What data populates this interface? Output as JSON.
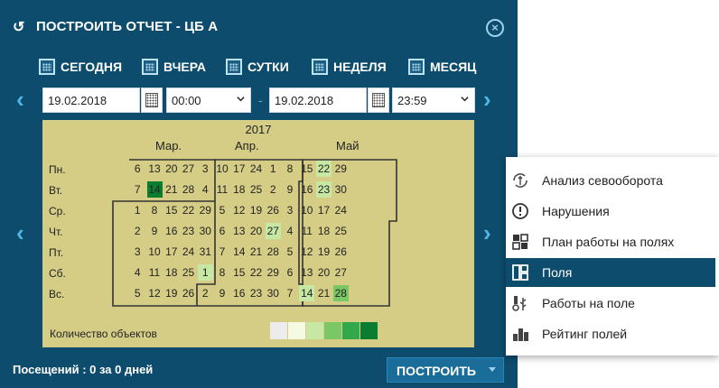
{
  "dialog": {
    "title": "ПОСТРОИТЬ ОТЧЕТ - ЦБ А",
    "quick_ranges": [
      "СЕГОДНЯ",
      "ВЧЕРА",
      "СУТКИ",
      "НЕДЕЛЯ",
      "МЕСЯЦ"
    ],
    "from_date": "19.02.2018",
    "from_time": "00:00",
    "separator": "-",
    "to_date": "19.02.2018",
    "to_time": "23:59"
  },
  "calendar": {
    "year": "2017",
    "months": [
      "Мар.",
      "Апр.",
      "Май"
    ],
    "weekdays": [
      "Пн.",
      "Вт.",
      "Ср.",
      "Чт.",
      "Пт.",
      "Сб.",
      "Вс."
    ],
    "weeks": [
      [
        "",
        "",
        "",
        "",
        "",
        "",
        ""
      ],
      [
        "6",
        "7",
        "1",
        "2",
        "3",
        "4",
        "5"
      ],
      [
        "13",
        "14",
        "8",
        "9",
        "10",
        "11",
        "12"
      ],
      [
        "20",
        "21",
        "15",
        "16",
        "17",
        "18",
        "19"
      ],
      [
        "27",
        "28",
        "22",
        "23",
        "24",
        "25",
        "26"
      ],
      [
        "3",
        "4",
        "29",
        "30",
        "31",
        "1",
        "2"
      ],
      [
        "10",
        "11",
        "5",
        "6",
        "7",
        "8",
        "9"
      ],
      [
        "17",
        "18",
        "12",
        "13",
        "14",
        "15",
        "16"
      ],
      [
        "24",
        "25",
        "19",
        "20",
        "21",
        "22",
        "23"
      ],
      [
        "1",
        "2",
        "26",
        "27",
        "28",
        "29",
        "30"
      ],
      [
        "8",
        "9",
        "3",
        "4",
        "5",
        "6",
        "7"
      ],
      [
        "15",
        "16",
        "10",
        "11",
        "12",
        "13",
        "14"
      ],
      [
        "22",
        "23",
        "17",
        "18",
        "19",
        "20",
        "21"
      ],
      [
        "29",
        "30",
        "24",
        "25",
        "26",
        "27",
        "28"
      ]
    ],
    "legend_label": "Количество объектов",
    "legend_colors": [
      "#ececec",
      "#f4fbe2",
      "#c6e8a4",
      "#79c865",
      "#31a84a",
      "#0b7d30"
    ]
  },
  "footer": {
    "visits": "Посещений : 0 за 0 дней",
    "build_label": "ПОСТРОИТЬ"
  },
  "menu": {
    "items": [
      {
        "label": "Анализ севооборота",
        "icon": "crop-rotation-icon"
      },
      {
        "label": "Нарушения",
        "icon": "warning-icon"
      },
      {
        "label": "План работы на полях",
        "icon": "plan-icon"
      },
      {
        "label": "Поля",
        "icon": "fields-icon",
        "active": true
      },
      {
        "label": "Работы на поле",
        "icon": "field-work-icon"
      },
      {
        "label": "Рейтинг полей",
        "icon": "rating-icon"
      }
    ]
  },
  "colors": {
    "dialog_bg": "#0e4c6e",
    "accent": "#4fb6e6",
    "calendar_bg": "#d5cd86",
    "menu_active": "#0e4c6e"
  }
}
